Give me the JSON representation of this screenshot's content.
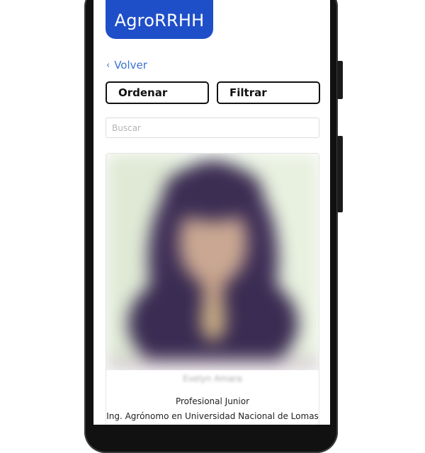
{
  "header": {
    "brand": "AgroRRHH"
  },
  "nav": {
    "back_label": "Volver",
    "back_icon": "chevron-left-icon"
  },
  "toolbar": {
    "order_label": "Ordenar",
    "filter_label": "Filtrar"
  },
  "search": {
    "placeholder": "Buscar",
    "value": ""
  },
  "profile_card": {
    "name": "Evelyn Amara",
    "role": "Profesional Junior",
    "degree": "Ing. Agrónomo en Universidad Nacional de Lomas"
  },
  "colors": {
    "brand": "#1f4fc8",
    "link": "#3b72d6"
  }
}
